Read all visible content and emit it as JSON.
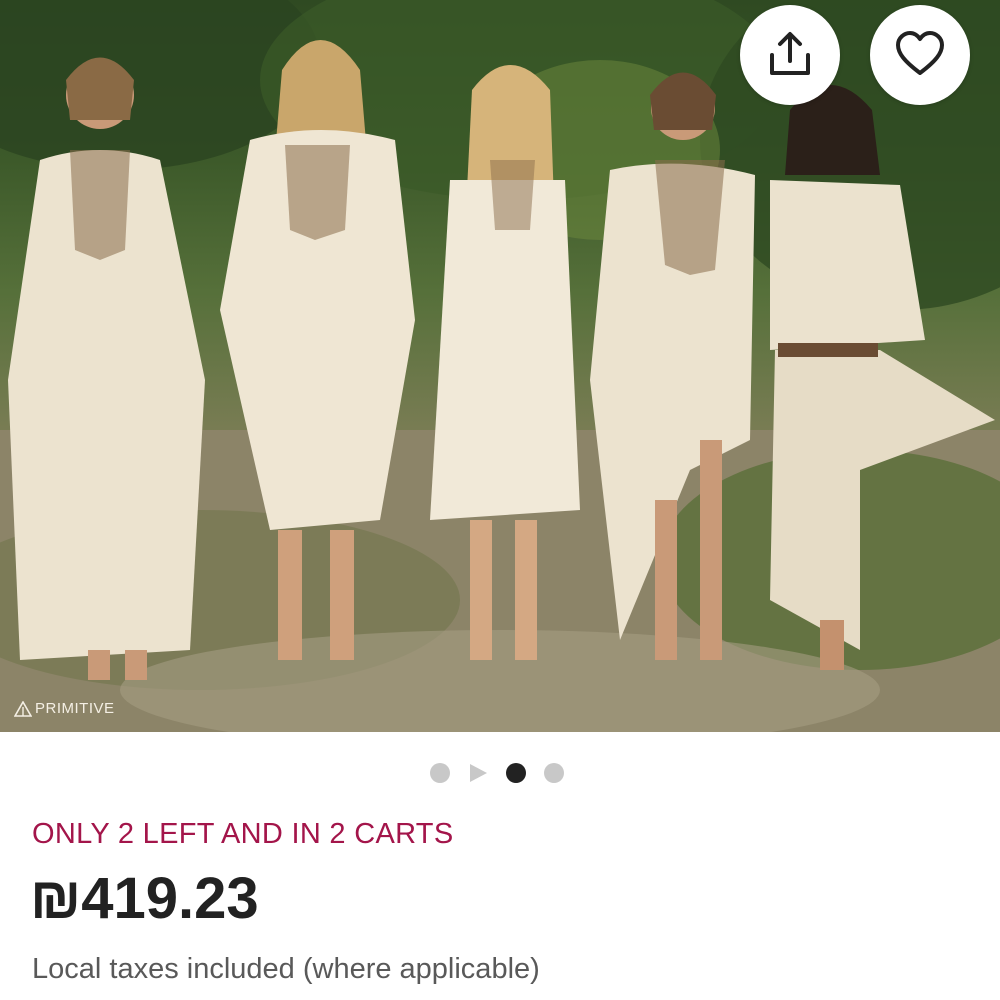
{
  "listing": {
    "image_watermark": "PRIMITIVE",
    "actions": {
      "share_icon": "share-icon",
      "favorite_icon": "heart-icon"
    },
    "carousel": {
      "total": 4,
      "active_index": 2,
      "video_index": 1
    },
    "stock_notice": "ONLY 2 LEFT AND IN 2 CARTS",
    "price": "₪419.23",
    "tax_note": "Local taxes included (where applicable)"
  },
  "colors": {
    "stock_notice": "#a3154a",
    "price": "#222222",
    "tax_note": "#595959",
    "dot_inactive": "#c8c8c8",
    "dot_active": "#222222"
  }
}
